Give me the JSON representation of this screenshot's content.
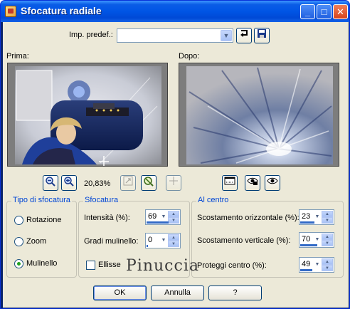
{
  "window": {
    "title": "Sfocatura radiale",
    "minimize": "_",
    "maximize": "□",
    "close": "✕"
  },
  "presets": {
    "label": "Imp. predef.:",
    "value": "",
    "arrow_icon": "chevron-down-icon",
    "reset_icon": "reset-arrow-icon",
    "save_icon": "floppy-icon"
  },
  "before": {
    "label": "Prima:"
  },
  "after": {
    "label": "Dopo:"
  },
  "zoom": {
    "value": "20,83%"
  },
  "tipo": {
    "title": "Tipo di sfocatura",
    "options": [
      "Rotazione",
      "Zoom",
      "Mulinello"
    ],
    "selected": "Mulinello"
  },
  "sfocatura": {
    "title": "Sfocatura",
    "intensity_label": "Intensità (%):",
    "intensity": "69",
    "twirl_label": "Gradi mulinello:",
    "twirl": "0",
    "ellipse_label": "Ellisse",
    "ellipse_checked": false
  },
  "centro": {
    "title": "Al centro",
    "horiz_label": "Scostamento orizzontale (%):",
    "horiz": "23",
    "vert_label": "Scostamento verticale (%):",
    "vert": "70",
    "protect_label": "Proteggi centro (%):",
    "protect": "49"
  },
  "watermark": "Pinuccia",
  "buttons": {
    "ok": "OK",
    "cancel": "Annulla",
    "help": "?"
  },
  "colors": {
    "titlebar": "#0055e5",
    "group_title": "#0046d5",
    "face": "#ece9d8"
  }
}
